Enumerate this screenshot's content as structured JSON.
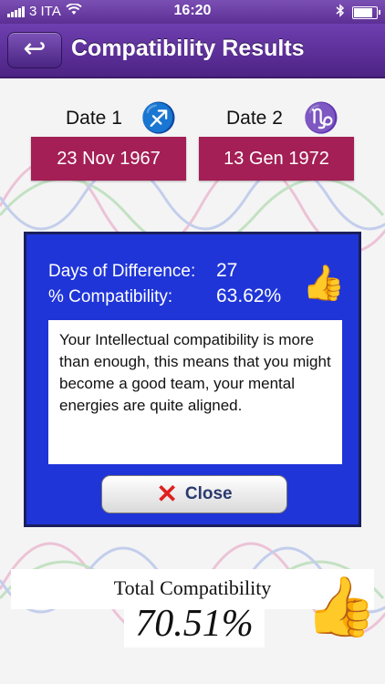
{
  "status": {
    "carrier": "3 ITA",
    "time": "16:20"
  },
  "nav": {
    "back_label": "↩",
    "title": "Compatibility Results"
  },
  "date1": {
    "label": "Date 1",
    "symbol": "♐",
    "value": "23 Nov 1967"
  },
  "date2": {
    "label": "Date 2",
    "symbol": "♑",
    "value": "13 Gen 1972"
  },
  "result": {
    "days_label": "Days of Difference:",
    "days_value": "27",
    "compat_label": "% Compatibility:",
    "compat_value": "63.62%",
    "message": "Your Intellectual compatibility is more than enough, this means that you might become a good team, your mental energies are quite aligned.",
    "close_label": "Close"
  },
  "total": {
    "title": "Total Compatibility",
    "value": "70.51%"
  },
  "icons": {
    "thumb": "thumbs-up-icon",
    "close": "close-icon",
    "back": "back-arrow-icon"
  },
  "colors": {
    "nav": "#5a2d91",
    "date_box": "#a31f55",
    "panel": "#1f35d8"
  }
}
